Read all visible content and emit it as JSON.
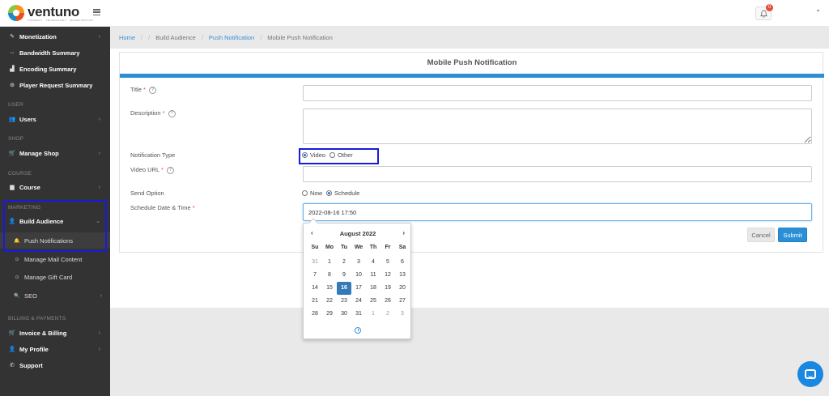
{
  "header": {
    "logo_text": "ventuno",
    "logo_tagline": "CONNECT · TECHNOLOGY · MONETIZATION",
    "notification_count": "0"
  },
  "sidebar": {
    "items": {
      "monetization": "Monetization",
      "bandwidth": "Bandwidth Summary",
      "encoding": "Encoding Summary",
      "player_request": "Player Request Summary",
      "users": "Users",
      "manage_shop": "Manage Shop",
      "course": "Course",
      "build_audience": "Build Audience",
      "push_notifications": "Push Notifications",
      "manage_mail": "Manage Mail Content",
      "manage_gift": "Manage Gift Card",
      "seo": "SEO",
      "invoice": "Invoice & Billing",
      "profile": "My Profile",
      "support": "Support"
    },
    "sections": {
      "user": "USER",
      "shop": "SHOP",
      "course": "COURSE",
      "marketing": "MARKETING",
      "billing": "BILLING & PAYMENTS"
    }
  },
  "breadcrumb": {
    "home": "Home",
    "build_audience": "Build Audience",
    "push_notification": "Push Notification",
    "current": "Mobile Push Notification"
  },
  "form": {
    "title": "Mobile Push Notification",
    "title_label": "Title",
    "description_label": "Description",
    "notification_type_label": "Notification Type",
    "video_url_label": "Video URL",
    "send_option_label": "Send Option",
    "schedule_label": "Schedule Date & Time",
    "required_mark": "*",
    "help_mark": "?",
    "type_options": [
      "Video",
      "Other"
    ],
    "type_selected": "Video",
    "send_options": [
      "Now",
      "Schedule"
    ],
    "send_selected": "Schedule",
    "schedule_value": "2022-08-16 17:50",
    "cancel_label": "Cancel",
    "submit_label": "Submit"
  },
  "datepicker": {
    "month_label": "August 2022",
    "prev": "‹",
    "next": "›",
    "weekdays": [
      "Su",
      "Mo",
      "Tu",
      "We",
      "Th",
      "Fr",
      "Sa"
    ],
    "days": [
      [
        "31",
        "1",
        "2",
        "3",
        "4",
        "5",
        "6"
      ],
      [
        "7",
        "8",
        "9",
        "10",
        "11",
        "12",
        "13"
      ],
      [
        "14",
        "15",
        "16",
        "17",
        "18",
        "19",
        "20"
      ],
      [
        "21",
        "22",
        "23",
        "24",
        "25",
        "26",
        "27"
      ],
      [
        "28",
        "29",
        "30",
        "31",
        "1",
        "2",
        "3"
      ]
    ],
    "selected_day": "16"
  }
}
